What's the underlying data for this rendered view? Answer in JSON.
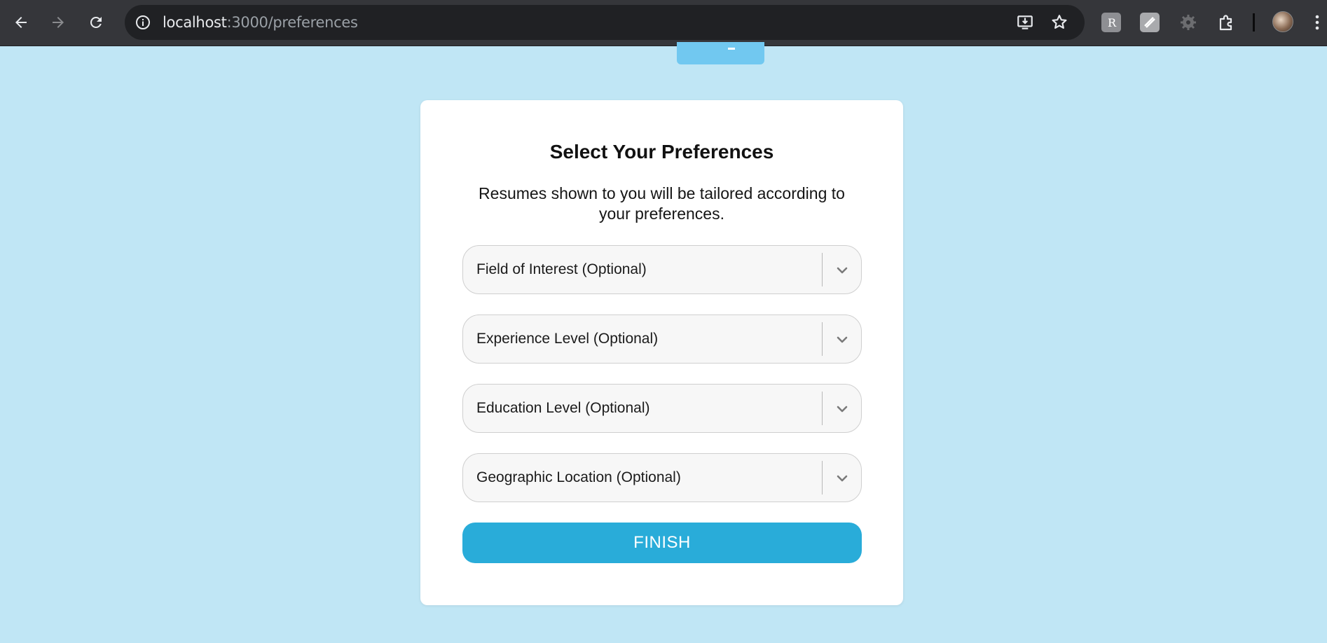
{
  "browser": {
    "url_host": "localhost",
    "url_path": ":3000/preferences",
    "icons": [
      "back-icon",
      "forward-icon",
      "reload-icon",
      "site-info-icon",
      "install-app-icon",
      "bookmark-star-icon",
      "extension-r-icon",
      "extension-pen-icon",
      "extension-gear-icon",
      "extensions-puzzle-icon",
      "profile-avatar",
      "menu-kebab-icon"
    ]
  },
  "card": {
    "title": "Select Your Preferences",
    "subtitle": "Resumes shown to you will be tailored according to your preferences.",
    "selects": [
      {
        "label": "Field of Interest (Optional)"
      },
      {
        "label": "Experience Level (Optional)"
      },
      {
        "label": "Education Level (Optional)"
      },
      {
        "label": "Geographic Location (Optional)"
      }
    ],
    "finish_label": "FINISH"
  },
  "colors": {
    "page_bg": "#c0e6f5",
    "accent": "#29acd9",
    "top_tab": "#71c8f0",
    "chrome_bg": "#35363a"
  }
}
